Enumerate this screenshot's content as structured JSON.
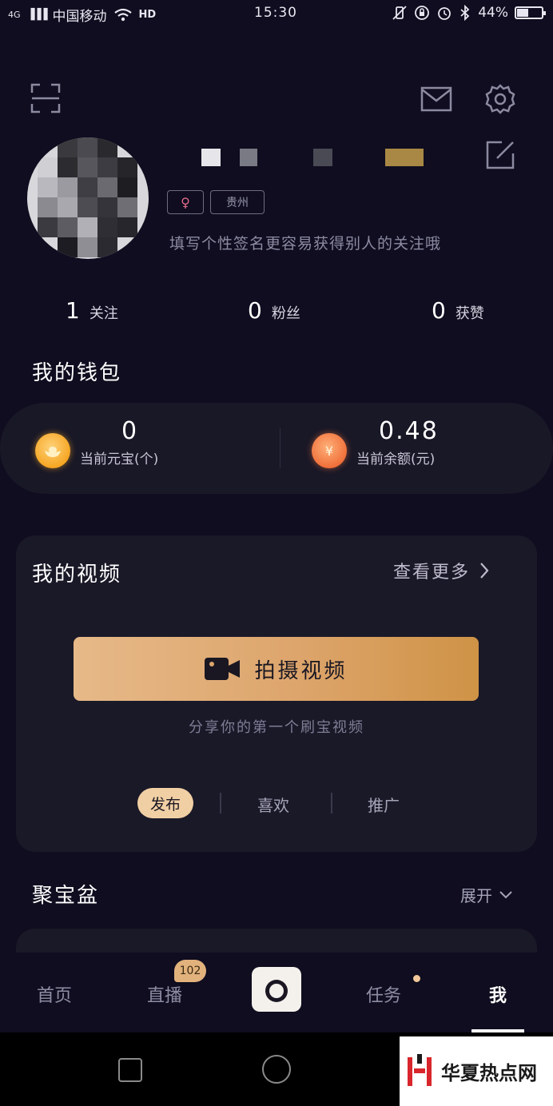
{
  "status_bar": {
    "network": "4G",
    "signal": "▐▐▐",
    "carrier": "中国移动",
    "wifi_icon": "wifi-icon",
    "call_icon": "HD",
    "time": "15:30",
    "right_icons": [
      "vibrate-off-icon",
      "lock-rotation-icon",
      "alarm-icon",
      "bluetooth-icon"
    ],
    "battery_percent": "44%",
    "battery_level": 0.44
  },
  "profile": {
    "gender_symbol": "♀",
    "location": "贵州",
    "signature": "填写个性签名更容易获得别人的关注哦"
  },
  "stats": [
    {
      "num": "1",
      "label": "关注"
    },
    {
      "num": "0",
      "label": "粉丝"
    },
    {
      "num": "0",
      "label": "获赞"
    }
  ],
  "wallet": {
    "title": "我的钱包",
    "ingot": {
      "value": "0",
      "label": "当前元宝(个)"
    },
    "balance": {
      "value": "0.48",
      "label": "当前余额(元)",
      "glyph": "¥"
    }
  },
  "videos": {
    "title": "我的视频",
    "more": "查看更多",
    "shoot_button": "拍摄视频",
    "share_hint": "分享你的第一个刷宝视频",
    "tabs": [
      "发布",
      "喜欢",
      "推广"
    ]
  },
  "treasure": {
    "title": "聚宝盆",
    "expand": "展开"
  },
  "bottom_nav": {
    "items": [
      "首页",
      "直播",
      "任务",
      "我"
    ],
    "live_badge": "102"
  },
  "watermark": {
    "text": "华夏热点网"
  },
  "colors": {
    "background": "#0f0d1f",
    "card": "#1a1928",
    "accent": "#dda56c",
    "pill": "#f1cfa4"
  }
}
